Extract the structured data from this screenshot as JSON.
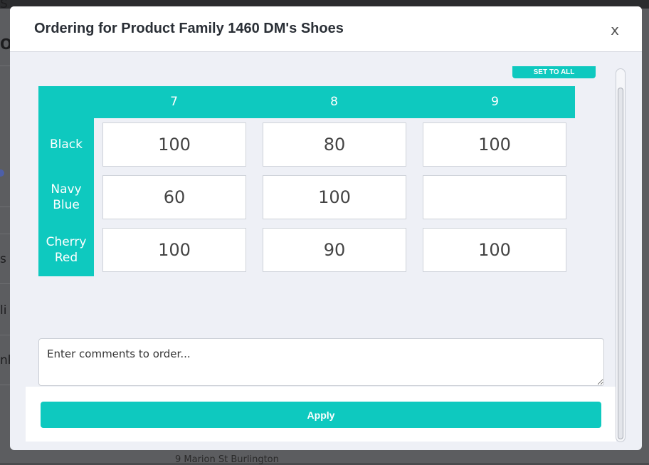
{
  "modal": {
    "title": "Ordering for Product Family 1460 DM's Shoes",
    "close_label": "x",
    "top_action_label": "SET TO ALL"
  },
  "grid": {
    "sizes": [
      "7",
      "8",
      "9"
    ],
    "colors": [
      "Black",
      "Navy Blue",
      "Cherry Red"
    ],
    "quantities": [
      [
        "100",
        "80",
        "100"
      ],
      [
        "60",
        "100",
        ""
      ],
      [
        "100",
        "90",
        "100"
      ]
    ]
  },
  "comments": {
    "placeholder": "Enter comments to order..."
  },
  "footer": {
    "apply_label": "Apply"
  },
  "background": {
    "fragments": [
      "S",
      "O",
      "s",
      "li",
      "nk"
    ],
    "address": "9 Marion St Burlington"
  },
  "colors": {
    "accent": "#0ec9bf",
    "modal_bg": "#eef0f6"
  }
}
